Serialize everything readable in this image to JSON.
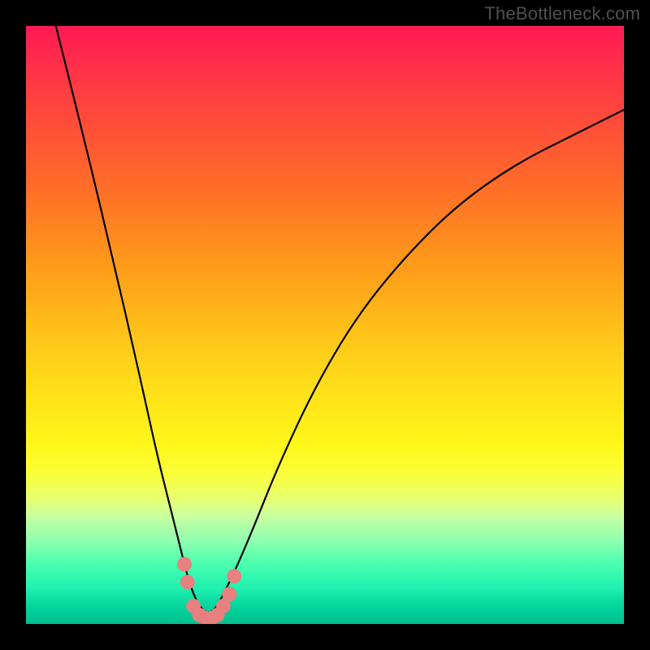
{
  "watermark": "TheBottleneck.com",
  "chart_data": {
    "type": "line",
    "title": "",
    "xlabel": "",
    "ylabel": "",
    "xlim": [
      0,
      100
    ],
    "ylim": [
      0,
      100
    ],
    "x": [
      5,
      10,
      15,
      18,
      20,
      22,
      24,
      26,
      27,
      28,
      29,
      30,
      31,
      32,
      33,
      35,
      38,
      42,
      48,
      55,
      63,
      72,
      82,
      92,
      100
    ],
    "series": [
      {
        "name": "bottleneck-curve",
        "values": [
          100,
          80,
          59,
          46,
          37,
          28,
          20,
          12,
          8,
          5,
          3,
          2,
          2,
          3,
          5,
          9,
          16,
          26,
          39,
          51,
          61,
          70,
          77,
          82,
          86
        ]
      }
    ],
    "markers": [
      {
        "x": 26.5,
        "y": 10,
        "color": "#e98080"
      },
      {
        "x": 27.0,
        "y": 7,
        "color": "#e98080"
      },
      {
        "x": 28.0,
        "y": 3,
        "color": "#e98080"
      },
      {
        "x": 29.0,
        "y": 1.5,
        "color": "#e98080"
      },
      {
        "x": 30.0,
        "y": 1,
        "color": "#e98080"
      },
      {
        "x": 31.0,
        "y": 1,
        "color": "#e98080"
      },
      {
        "x": 32.0,
        "y": 1.5,
        "color": "#e98080"
      },
      {
        "x": 33.0,
        "y": 3,
        "color": "#e98080"
      },
      {
        "x": 34.0,
        "y": 5,
        "color": "#e98080"
      },
      {
        "x": 34.8,
        "y": 8,
        "color": "#e98080"
      }
    ],
    "gradient_bands": [
      {
        "y": 100,
        "color": "#ff1a55"
      },
      {
        "y": 70,
        "color": "#ff9b1a"
      },
      {
        "y": 30,
        "color": "#fff71a"
      },
      {
        "y": 10,
        "color": "#c0ff90"
      },
      {
        "y": 0,
        "color": "#00c090"
      }
    ]
  }
}
